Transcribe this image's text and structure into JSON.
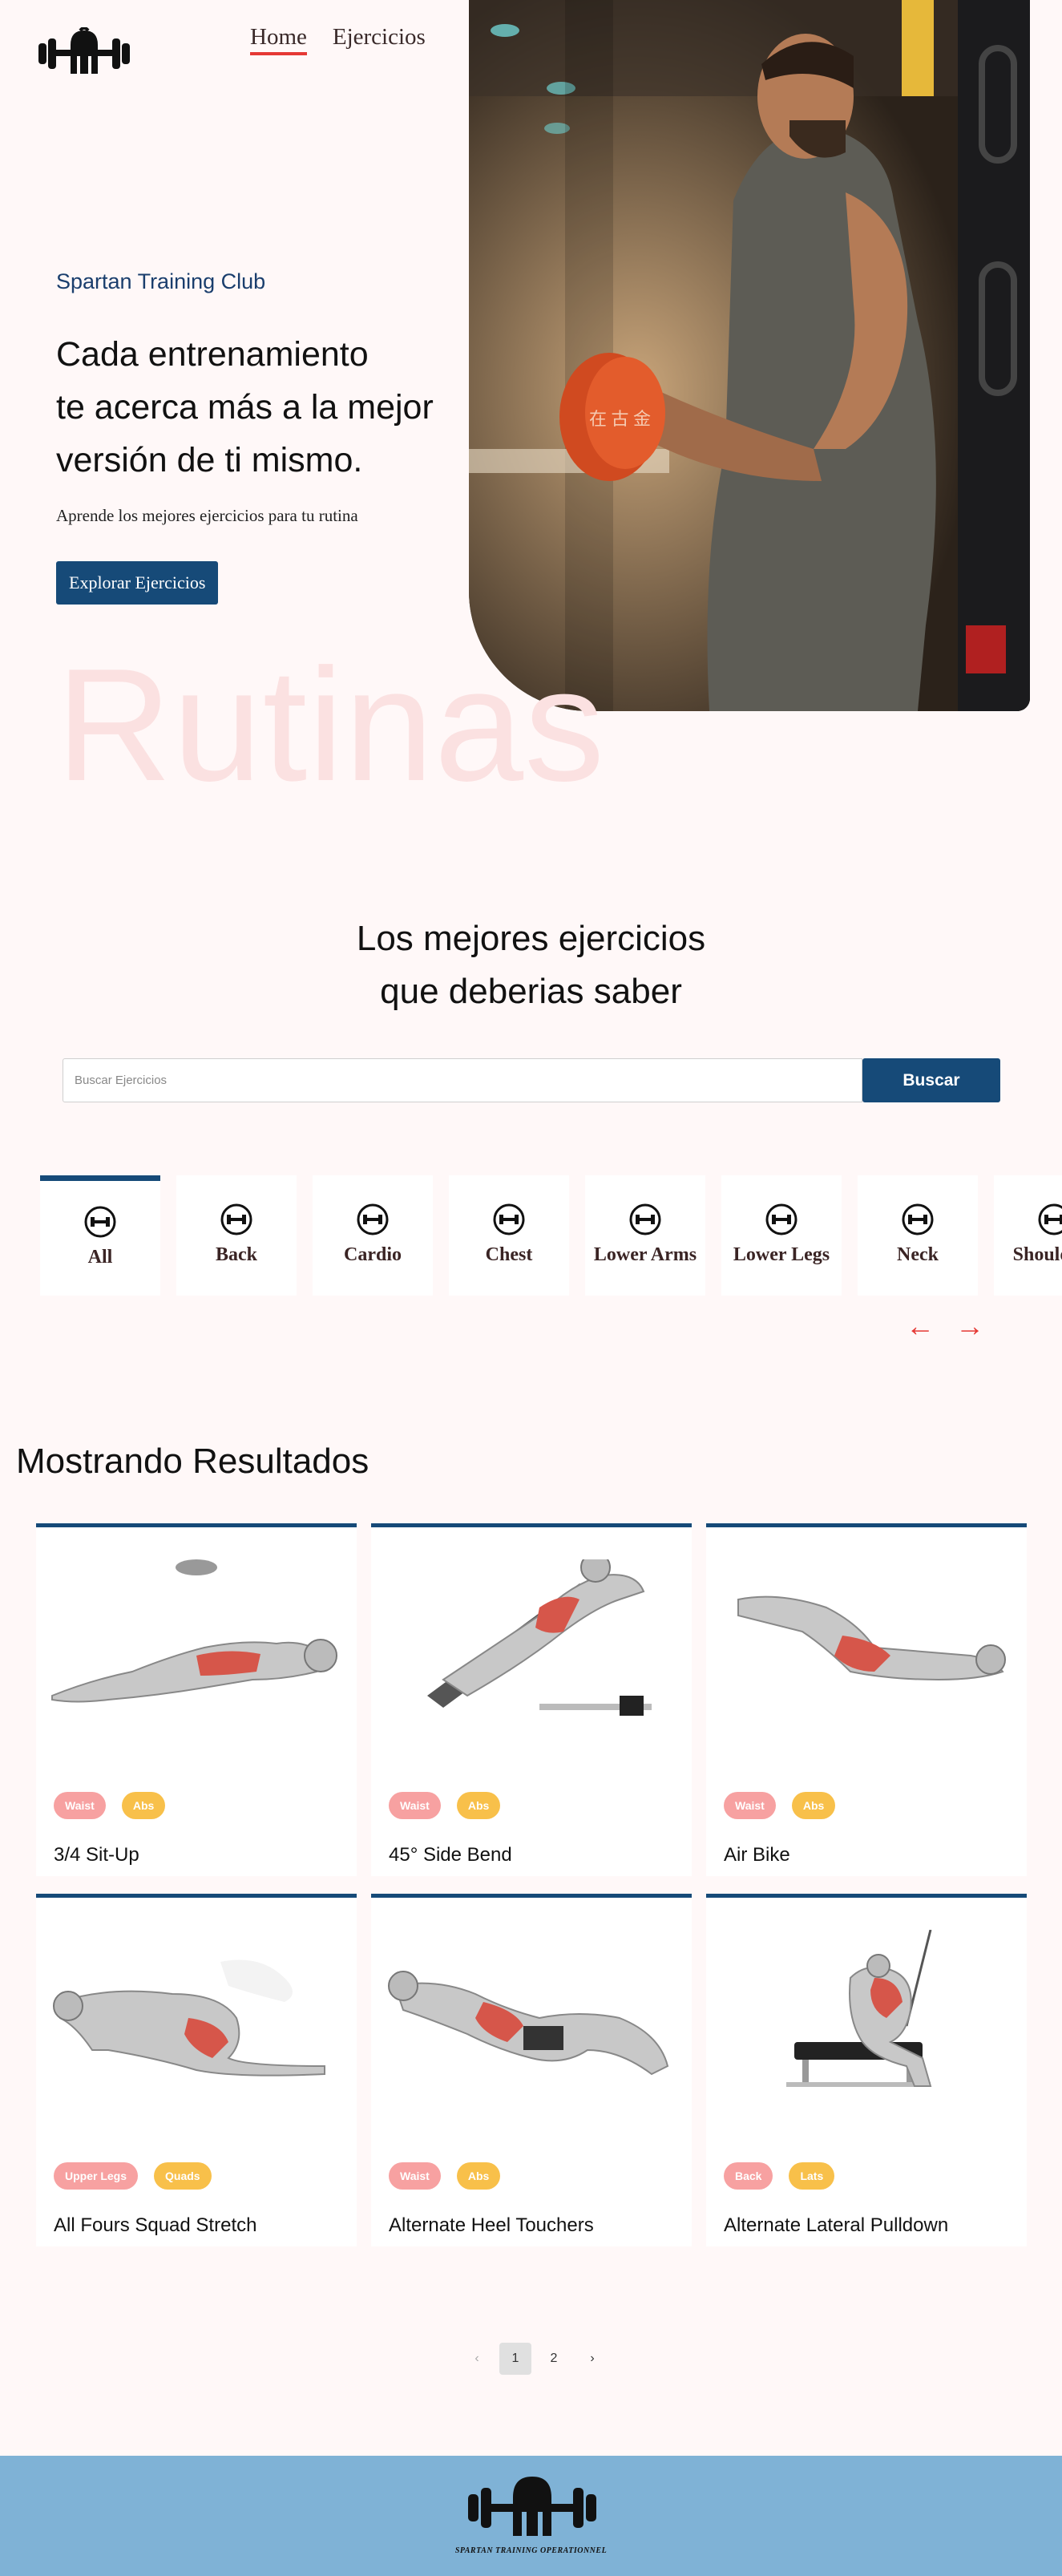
{
  "nav": {
    "logo_icon": "spartan-dumbbell-logo",
    "links": [
      {
        "label": "Home",
        "active": true
      },
      {
        "label": "Ejercicios",
        "active": false
      }
    ]
  },
  "hero": {
    "subtitle": "Spartan Training Club",
    "title_line1": "Cada entrenamiento",
    "title_line2": "te acerca más a la mejor",
    "title_line3": "versión de ti mismo.",
    "description": "Aprende los mejores ejercicios para tu rutina",
    "button_label": "Explorar Ejercicios",
    "photo_subject": "man-curling-dumbbell-photo"
  },
  "watermark": "Rutinas",
  "section": {
    "heading_line1": "Los mejores ejercicios",
    "heading_line2": "que deberias saber"
  },
  "search": {
    "placeholder": "Buscar Ejercicios",
    "value": "",
    "button_label": "Buscar"
  },
  "categories": [
    {
      "label": "All",
      "active": true
    },
    {
      "label": "Back",
      "active": false
    },
    {
      "label": "Cardio",
      "active": false
    },
    {
      "label": "Chest",
      "active": false
    },
    {
      "label": "Lower Arms",
      "active": false
    },
    {
      "label": "Lower Legs",
      "active": false
    },
    {
      "label": "Neck",
      "active": false
    },
    {
      "label": "Shoulders",
      "active": false
    }
  ],
  "carousel": {
    "prev_icon": "arrow-left-icon",
    "next_icon": "arrow-right-icon"
  },
  "results": {
    "title": "Mostrando Resultados",
    "cards": [
      {
        "name": "3/4 Sit-Up",
        "tags": [
          "Waist",
          "Abs"
        ]
      },
      {
        "name": "45° Side Bend",
        "tags": [
          "Waist",
          "Abs"
        ]
      },
      {
        "name": "Air Bike",
        "tags": [
          "Waist",
          "Abs"
        ]
      },
      {
        "name": "All Fours Squad Stretch",
        "tags": [
          "Upper Legs",
          "Quads"
        ]
      },
      {
        "name": "Alternate Heel Touchers",
        "tags": [
          "Waist",
          "Abs"
        ]
      },
      {
        "name": "Alternate Lateral Pulldown",
        "tags": [
          "Back",
          "Lats"
        ]
      }
    ]
  },
  "pagination": {
    "prev_icon": "chevron-left-icon",
    "pages": [
      "1",
      "2"
    ],
    "current": "1",
    "next_icon": "chevron-right-icon"
  },
  "footer": {
    "text": "SPARTAN TRAINING OPERATIONNEL"
  },
  "colors": {
    "primary": "#164a78",
    "accent": "#e53935",
    "tag_primary": "#f7a1a1",
    "tag_secondary": "#f8c04a",
    "footer_bg": "#7fb2d6",
    "page_bg": "#fff8f8"
  }
}
